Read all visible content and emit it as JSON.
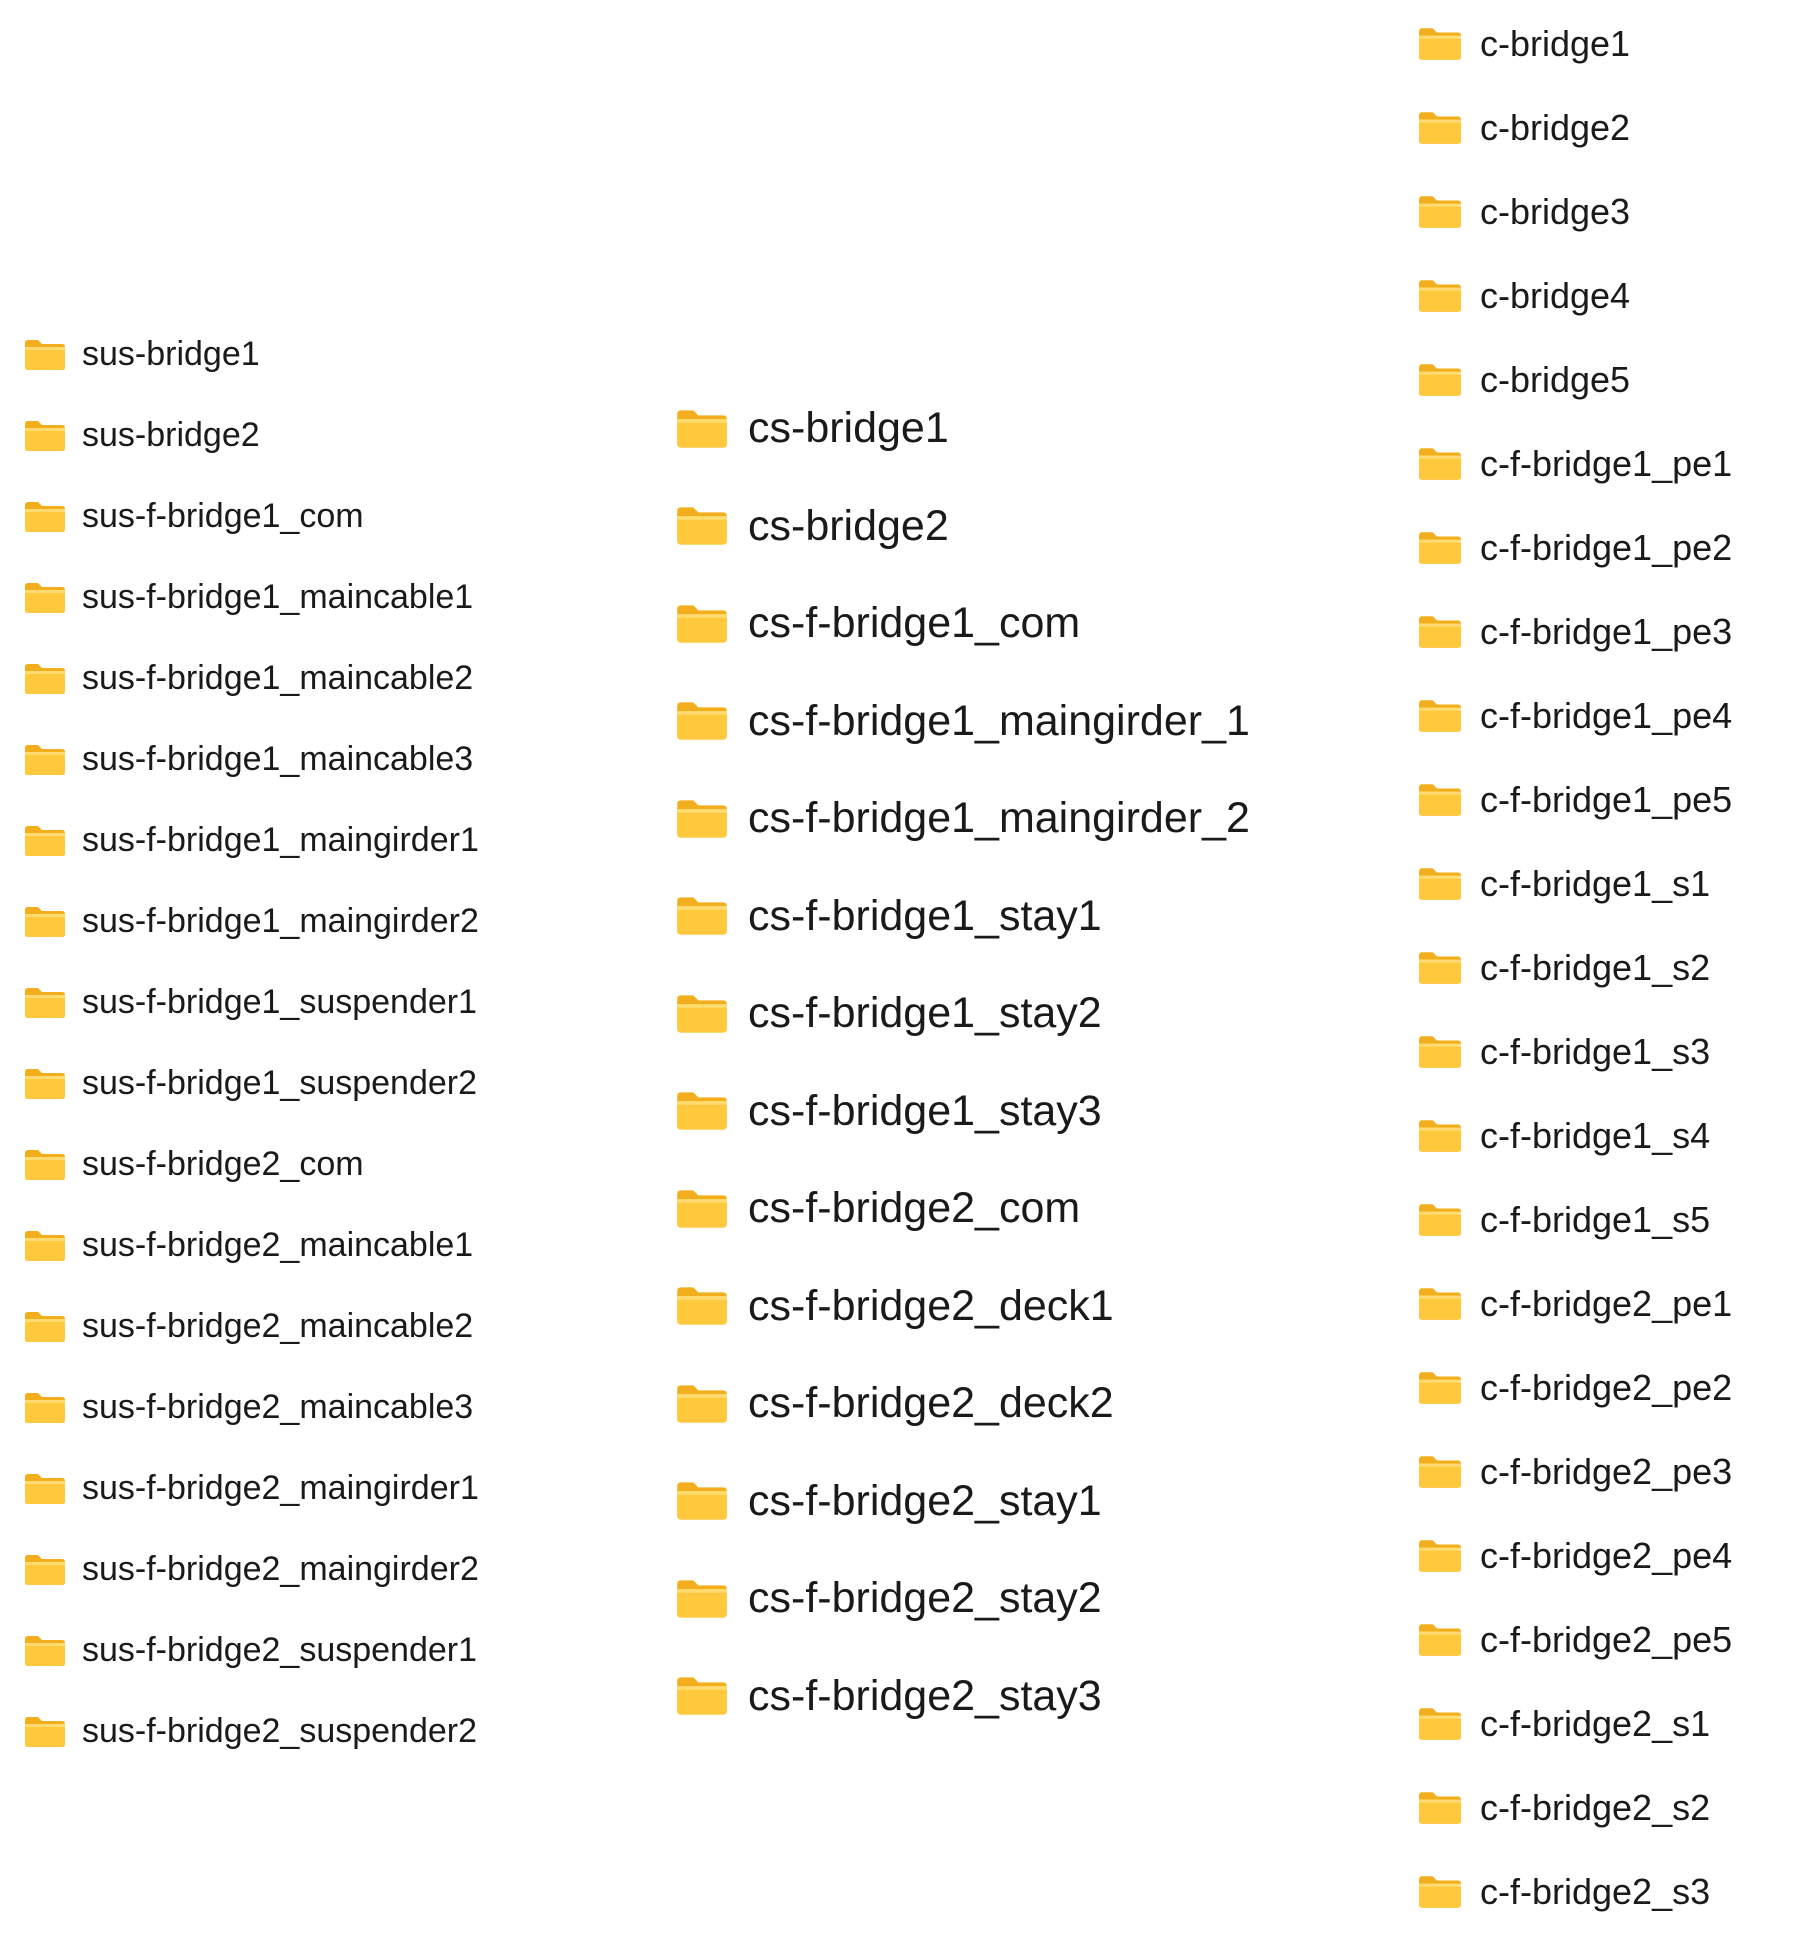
{
  "icon": "folder-icon",
  "colors": {
    "folder_body": "#FFC83D",
    "folder_back": "#F2AE1C",
    "folder_highlight": "#FFDB70",
    "text": "#1a1a1a",
    "background": "#ffffff"
  },
  "columns": [
    {
      "group": "sus",
      "folders": [
        "sus-bridge1",
        "sus-bridge2",
        "sus-f-bridge1_com",
        "sus-f-bridge1_maincable1",
        "sus-f-bridge1_maincable2",
        "sus-f-bridge1_maincable3",
        "sus-f-bridge1_maingirder1",
        "sus-f-bridge1_maingirder2",
        "sus-f-bridge1_suspender1",
        "sus-f-bridge1_suspender2",
        "sus-f-bridge2_com",
        "sus-f-bridge2_maincable1",
        "sus-f-bridge2_maincable2",
        "sus-f-bridge2_maincable3",
        "sus-f-bridge2_maingirder1",
        "sus-f-bridge2_maingirder2",
        "sus-f-bridge2_suspender1",
        "sus-f-bridge2_suspender2"
      ]
    },
    {
      "group": "cs",
      "folders": [
        "cs-bridge1",
        "cs-bridge2",
        "cs-f-bridge1_com",
        "cs-f-bridge1_maingirder_1",
        "cs-f-bridge1_maingirder_2",
        "cs-f-bridge1_stay1",
        "cs-f-bridge1_stay2",
        "cs-f-bridge1_stay3",
        "cs-f-bridge2_com",
        "cs-f-bridge2_deck1",
        "cs-f-bridge2_deck2",
        "cs-f-bridge2_stay1",
        "cs-f-bridge2_stay2",
        "cs-f-bridge2_stay3"
      ]
    },
    {
      "group": "c",
      "folders": [
        "c-bridge1",
        "c-bridge2",
        "c-bridge3",
        "c-bridge4",
        "c-bridge5",
        "c-f-bridge1_pe1",
        "c-f-bridge1_pe2",
        "c-f-bridge1_pe3",
        "c-f-bridge1_pe4",
        "c-f-bridge1_pe5",
        "c-f-bridge1_s1",
        "c-f-bridge1_s2",
        "c-f-bridge1_s3",
        "c-f-bridge1_s4",
        "c-f-bridge1_s5",
        "c-f-bridge2_pe1",
        "c-f-bridge2_pe2",
        "c-f-bridge2_pe3",
        "c-f-bridge2_pe4",
        "c-f-bridge2_pe5",
        "c-f-bridge2_s1",
        "c-f-bridge2_s2",
        "c-f-bridge2_s3"
      ]
    }
  ]
}
